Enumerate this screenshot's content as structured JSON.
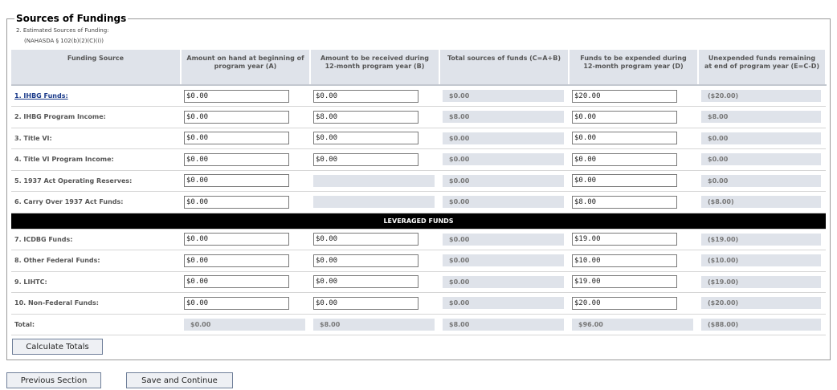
{
  "section_title": "Sources of Fundings",
  "subtitle1": "2. Estimated Sources of Funding:",
  "subtitle2": "(NAHASDA § 102(b)(2)(C)(i))",
  "headers": {
    "source": "Funding Source",
    "a": "Amount on hand at beginning of program year (A)",
    "b": "Amount to be received during 12-month program year (B)",
    "c": "Total sources of funds (C=A+B)",
    "d": "Funds to be expended during 12-month program year (D)",
    "e": "Unexpended funds remaining at end of program year (E=C-D)"
  },
  "rows": [
    {
      "label": "1. IHBG Funds:",
      "a": "$0.00",
      "b": "$0.00",
      "c": "$0.00",
      "d": "$20.00",
      "e": "($20.00)"
    },
    {
      "label": "2. IHBG Program Income:",
      "a": "$0.00",
      "b": "$8.00",
      "c": "$8.00",
      "d": "$0.00",
      "e": "$8.00"
    },
    {
      "label": "3. Title VI:",
      "a": "$0.00",
      "b": "$0.00",
      "c": "$0.00",
      "d": "$0.00",
      "e": "$0.00"
    },
    {
      "label": "4. Title VI Program Income:",
      "a": "$0.00",
      "b": "$0.00",
      "c": "$0.00",
      "d": "$0.00",
      "e": "$0.00"
    },
    {
      "label": "5. 1937 Act Operating Reserves:",
      "a": "$0.00",
      "c": "$0.00",
      "d": "$0.00",
      "e": "$0.00"
    },
    {
      "label": "6. Carry Over 1937 Act Funds:",
      "a": "$0.00",
      "c": "$0.00",
      "d": "$8.00",
      "e": "($8.00)"
    }
  ],
  "leveraged_label": "LEVERAGED FUNDS",
  "leveraged_rows": [
    {
      "label": "7. ICDBG Funds:",
      "a": "$0.00",
      "b": "$0.00",
      "c": "$0.00",
      "d": "$19.00",
      "e": "($19.00)"
    },
    {
      "label": "8. Other Federal Funds:",
      "a": "$0.00",
      "b": "$0.00",
      "c": "$0.00",
      "d": "$10.00",
      "e": "($10.00)"
    },
    {
      "label": "9. LIHTC:",
      "a": "$0.00",
      "b": "$0.00",
      "c": "$0.00",
      "d": "$19.00",
      "e": "($19.00)"
    },
    {
      "label": "10. Non-Federal Funds:",
      "a": "$0.00",
      "b": "$0.00",
      "c": "$0.00",
      "d": "$20.00",
      "e": "($20.00)"
    }
  ],
  "totals": {
    "label": "Total:",
    "a": "$0.00",
    "b": "$8.00",
    "c": "$8.00",
    "d": "$96.00",
    "e": "($88.00)"
  },
  "buttons": {
    "calculate": "Calculate Totals",
    "previous": "Previous Section",
    "save": "Save and Continue"
  }
}
